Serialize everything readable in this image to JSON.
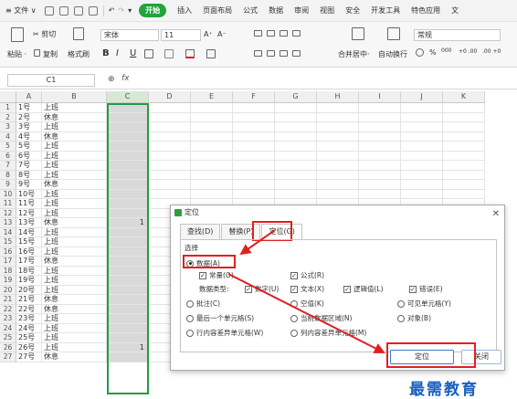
{
  "menu": {
    "file": "≡ 文件 ∨",
    "start": "开始",
    "tabs": [
      "插入",
      "页面布局",
      "公式",
      "数据",
      "审阅",
      "视图",
      "安全",
      "开发工具",
      "特色应用",
      "文"
    ]
  },
  "ribbon": {
    "paste": "粘贴 ·",
    "cut": "✂ 剪切",
    "copy": "复制",
    "format_painter": "格式刷",
    "font_name": "宋体",
    "font_size": "11",
    "grow_font": "A⁺",
    "shrink_font": "A⁻",
    "bold": "B",
    "italic": "I",
    "underline": "U",
    "merge_center": "合并居中·",
    "wrap_text": "自动换行",
    "number_format": "常规",
    "percent": "%",
    "thousands": "000",
    "inc_decimal": "+0 .00",
    "dec_decimal": ".00 +0"
  },
  "formula_bar": {
    "name_box": "C1",
    "fx": "fx"
  },
  "columns": [
    "A",
    "B",
    "C",
    "D",
    "E",
    "F",
    "G",
    "H",
    "I",
    "J",
    "K"
  ],
  "rows": [
    {
      "n": "1",
      "a": "1号",
      "b": "上班",
      "c": ""
    },
    {
      "n": "2",
      "a": "2号",
      "b": "休息",
      "c": ""
    },
    {
      "n": "3",
      "a": "3号",
      "b": "上班",
      "c": ""
    },
    {
      "n": "4",
      "a": "4号",
      "b": "休息",
      "c": ""
    },
    {
      "n": "5",
      "a": "5号",
      "b": "上班",
      "c": ""
    },
    {
      "n": "6",
      "a": "6号",
      "b": "上班",
      "c": ""
    },
    {
      "n": "7",
      "a": "7号",
      "b": "上班",
      "c": ""
    },
    {
      "n": "8",
      "a": "8号",
      "b": "上班",
      "c": ""
    },
    {
      "n": "9",
      "a": "9号",
      "b": "休息",
      "c": ""
    },
    {
      "n": "10",
      "a": "10号",
      "b": "上班",
      "c": ""
    },
    {
      "n": "11",
      "a": "11号",
      "b": "上班",
      "c": ""
    },
    {
      "n": "12",
      "a": "12号",
      "b": "上班",
      "c": ""
    },
    {
      "n": "13",
      "a": "13号",
      "b": "休息",
      "c": "1"
    },
    {
      "n": "14",
      "a": "14号",
      "b": "上班",
      "c": ""
    },
    {
      "n": "15",
      "a": "15号",
      "b": "上班",
      "c": ""
    },
    {
      "n": "16",
      "a": "16号",
      "b": "上班",
      "c": ""
    },
    {
      "n": "17",
      "a": "17号",
      "b": "休息",
      "c": ""
    },
    {
      "n": "18",
      "a": "18号",
      "b": "上班",
      "c": ""
    },
    {
      "n": "19",
      "a": "19号",
      "b": "上班",
      "c": ""
    },
    {
      "n": "20",
      "a": "20号",
      "b": "上班",
      "c": ""
    },
    {
      "n": "21",
      "a": "21号",
      "b": "休息",
      "c": ""
    },
    {
      "n": "22",
      "a": "22号",
      "b": "休息",
      "c": ""
    },
    {
      "n": "23",
      "a": "23号",
      "b": "上班",
      "c": ""
    },
    {
      "n": "24",
      "a": "24号",
      "b": "上班",
      "c": ""
    },
    {
      "n": "25",
      "a": "25号",
      "b": "上班",
      "c": ""
    },
    {
      "n": "26",
      "a": "26号",
      "b": "上班",
      "c": "1"
    },
    {
      "n": "27",
      "a": "27号",
      "b": "休息",
      "c": ""
    }
  ],
  "dialog": {
    "title": "定位",
    "close": "✕",
    "tabs": [
      "查找(D)",
      "替换(P)",
      "定位(G)"
    ],
    "section": "选择",
    "data": "数据(A)",
    "constant": "常量(O)",
    "formula": "公式(R)",
    "data_types": "数据类型:",
    "number": "数字(U)",
    "text": "文本(X)",
    "logical": "逻辑值(L)",
    "error": "错误(E)",
    "comment": "批注(C)",
    "blank": "空值(K)",
    "visible": "可见单元格(Y)",
    "last_cell": "最后一个单元格(S)",
    "current_region": "当前数据区域(N)",
    "object": "对象(B)",
    "row_diff": "行内容差异单元格(W)",
    "col_diff": "列内容差异单元格(M)",
    "ok": "定位",
    "cancel": "关闭"
  },
  "watermark": "最需教育",
  "colors": {
    "accent_green": "#1fa539",
    "highlight_red": "#e02020",
    "watermark_blue": "#1a5fbf"
  }
}
